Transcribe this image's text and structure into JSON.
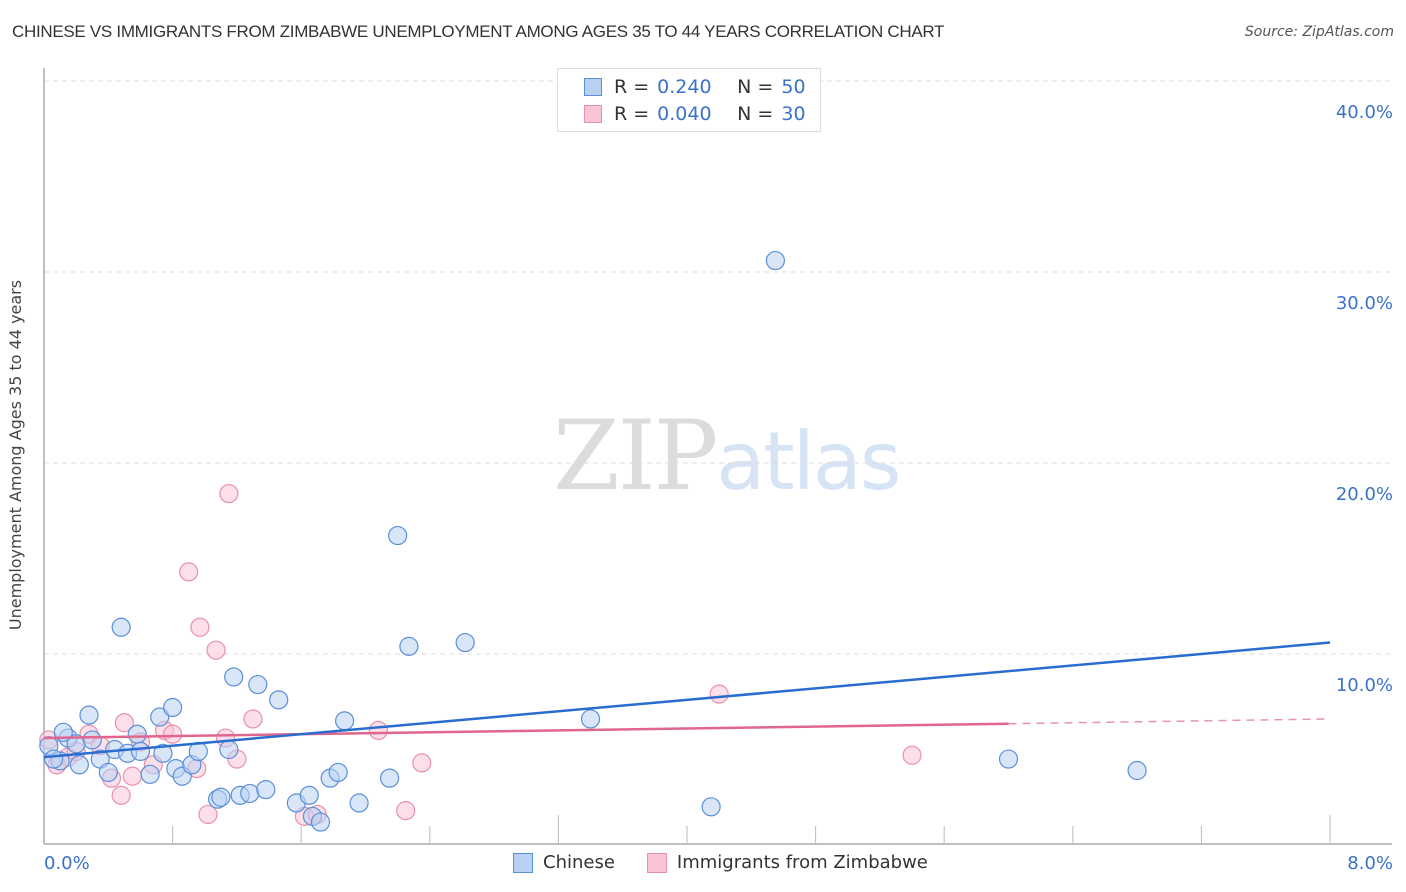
{
  "header": {
    "title": "CHINESE VS IMMIGRANTS FROM ZIMBABWE UNEMPLOYMENT AMONG AGES 35 TO 44 YEARS CORRELATION CHART",
    "source": "Source: ZipAtlas.com"
  },
  "watermark": {
    "zip": "ZIP",
    "atlas": "atlas"
  },
  "legend_top": {
    "rows": [
      {
        "r_label": "R =",
        "r_value": "0.240",
        "n_label": "N =",
        "n_value": "50"
      },
      {
        "r_label": "R =",
        "r_value": "0.040",
        "n_label": "N =",
        "n_value": "30"
      }
    ]
  },
  "legend_bottom": {
    "items": [
      {
        "label": "Chinese"
      },
      {
        "label": "Immigrants from Zimbabwe"
      }
    ]
  },
  "colors": {
    "chinese_fill": "#b8d1f3",
    "chinese_stroke": "#5b8fd9",
    "chinese_line": "#2a6dd1",
    "zimbabwe_fill": "#f9c5d5",
    "zimbabwe_stroke": "#e890ac",
    "zimbabwe_line": "#e0658f",
    "tick_label": "#3b72c9"
  },
  "chart_data": {
    "type": "scatter",
    "title": "CHINESE VS IMMIGRANTS FROM ZIMBABWE UNEMPLOYMENT AMONG AGES 35 TO 44 YEARS CORRELATION CHART",
    "xlabel": "",
    "ylabel": "Unemployment Among Ages 35 to 44 years",
    "xlim": [
      0,
      8
    ],
    "ylim": [
      0,
      42
    ],
    "x_tick_labels": [
      "0.0%",
      "8.0%"
    ],
    "y_ticks": [
      10,
      20,
      30,
      40
    ],
    "y_tick_labels": [
      "10.0%",
      "20.0%",
      "30.0%",
      "40.0%"
    ],
    "grid": true,
    "legend": "top-center",
    "series": [
      {
        "name": "Chinese",
        "R": 0.24,
        "N": 50,
        "trend": {
          "x": [
            0,
            8
          ],
          "y": [
            4.6,
            10.6
          ],
          "dashed_from": null
        },
        "points": [
          [
            0.03,
            5.2
          ],
          [
            0.1,
            4.4
          ],
          [
            0.15,
            5.6
          ],
          [
            0.2,
            5.3
          ],
          [
            0.22,
            4.2
          ],
          [
            0.28,
            6.8
          ],
          [
            0.3,
            5.5
          ],
          [
            0.35,
            4.5
          ],
          [
            0.4,
            3.8
          ],
          [
            0.44,
            5.0
          ],
          [
            0.48,
            11.4
          ],
          [
            0.52,
            4.8
          ],
          [
            0.58,
            5.8
          ],
          [
            0.6,
            4.9
          ],
          [
            0.66,
            3.7
          ],
          [
            0.72,
            6.7
          ],
          [
            0.74,
            4.8
          ],
          [
            0.8,
            7.2
          ],
          [
            0.82,
            4.0
          ],
          [
            0.86,
            3.6
          ],
          [
            0.92,
            4.2
          ],
          [
            0.96,
            4.9
          ],
          [
            1.08,
            2.4
          ],
          [
            1.1,
            2.5
          ],
          [
            1.15,
            5.0
          ],
          [
            1.18,
            8.8
          ],
          [
            1.22,
            2.6
          ],
          [
            1.28,
            2.7
          ],
          [
            1.33,
            8.4
          ],
          [
            1.38,
            2.9
          ],
          [
            1.46,
            7.6
          ],
          [
            1.57,
            2.2
          ],
          [
            1.65,
            2.6
          ],
          [
            1.67,
            1.5
          ],
          [
            1.72,
            1.2
          ],
          [
            1.78,
            3.5
          ],
          [
            1.83,
            3.8
          ],
          [
            1.87,
            6.5
          ],
          [
            1.96,
            2.2
          ],
          [
            2.15,
            3.5
          ],
          [
            2.2,
            16.2
          ],
          [
            2.27,
            10.4
          ],
          [
            2.62,
            10.6
          ],
          [
            3.4,
            6.6
          ],
          [
            4.15,
            2.0
          ],
          [
            4.55,
            30.6
          ],
          [
            6.0,
            4.5
          ],
          [
            6.8,
            3.9
          ],
          [
            0.06,
            4.5
          ],
          [
            0.12,
            5.9
          ]
        ]
      },
      {
        "name": "Immigrants from Zimbabwe",
        "R": 0.04,
        "N": 30,
        "trend": {
          "x": [
            0,
            8
          ],
          "y": [
            5.6,
            6.6
          ],
          "dashed_from": 6.0
        },
        "points": [
          [
            0.03,
            5.5
          ],
          [
            0.08,
            4.2
          ],
          [
            0.15,
            4.6
          ],
          [
            0.2,
            4.9
          ],
          [
            0.28,
            5.8
          ],
          [
            0.35,
            5.2
          ],
          [
            0.42,
            3.5
          ],
          [
            0.48,
            2.6
          ],
          [
            0.55,
            3.6
          ],
          [
            0.6,
            5.4
          ],
          [
            0.68,
            4.2
          ],
          [
            0.75,
            6.0
          ],
          [
            0.8,
            5.8
          ],
          [
            0.9,
            14.3
          ],
          [
            0.95,
            4.0
          ],
          [
            0.97,
            11.4
          ],
          [
            1.02,
            1.6
          ],
          [
            1.07,
            10.2
          ],
          [
            1.13,
            5.6
          ],
          [
            1.15,
            18.4
          ],
          [
            1.2,
            4.5
          ],
          [
            1.3,
            6.6
          ],
          [
            1.62,
            1.5
          ],
          [
            1.7,
            1.6
          ],
          [
            2.08,
            6.0
          ],
          [
            2.25,
            1.8
          ],
          [
            2.35,
            4.3
          ],
          [
            4.2,
            7.9
          ],
          [
            5.4,
            4.7
          ],
          [
            0.5,
            6.4
          ]
        ]
      }
    ]
  }
}
